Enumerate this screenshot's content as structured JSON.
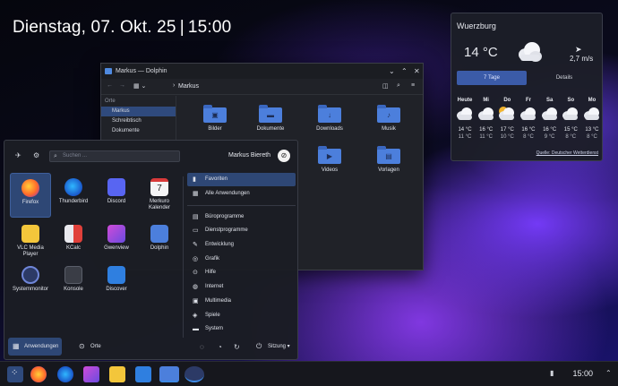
{
  "desktop": {
    "date": "Dienstag, 07. Okt. 25",
    "time": "15:00"
  },
  "weather": {
    "city": "Wuerzburg",
    "temp": "14 °C",
    "wind": "2,7 m/s",
    "tabs": [
      "7 Tage",
      "Details"
    ],
    "days": [
      {
        "name": "Heute",
        "hi": "14 °C",
        "lo": "11 °C",
        "icon": "cloud-icon"
      },
      {
        "name": "Mi",
        "hi": "16 °C",
        "lo": "11 °C",
        "icon": "cloud-icon"
      },
      {
        "name": "Do",
        "hi": "17 °C",
        "lo": "10 °C",
        "icon": "partly-sunny-icon"
      },
      {
        "name": "Fr",
        "hi": "16 °C",
        "lo": "8 °C",
        "icon": "cloud-icon"
      },
      {
        "name": "Sa",
        "hi": "16 °C",
        "lo": "9 °C",
        "icon": "cloud-icon"
      },
      {
        "name": "So",
        "hi": "15 °C",
        "lo": "8 °C",
        "icon": "cloud-icon"
      },
      {
        "name": "Mo",
        "hi": "13 °C",
        "lo": "8 °C",
        "icon": "cloud-icon"
      }
    ],
    "source": "Quelle: Deutscher Wetterdienst"
  },
  "dolphin": {
    "title": "Markus — Dolphin",
    "breadcrumb": "Markus",
    "sidebar_header": "Orte",
    "sidebar": [
      "Markus",
      "Schreibtisch",
      "Dokumente"
    ],
    "files": [
      "Bilder",
      "Dokumente",
      "Downloads",
      "Musik",
      "Videos",
      "Vorlagen"
    ]
  },
  "launcher": {
    "search_placeholder": "Suchen ...",
    "user": "Markus Biereth",
    "apps": [
      "Firefox",
      "Thunderbird",
      "Discord",
      "Merkuro Kalender",
      "VLC Media Player",
      "KCalc",
      "Gwenview",
      "Dolphin",
      "Systemmonitor",
      "Konsole",
      "Discover"
    ],
    "calendar_day": "7",
    "categories": [
      "Favoriten",
      "Alle Anwendungen",
      "Büroprogramme",
      "Dienstprogramme",
      "Entwicklung",
      "Grafik",
      "Hilfe",
      "Internet",
      "Multimedia",
      "Spiele",
      "System"
    ],
    "footer": {
      "apps": "Anwendungen",
      "places": "Orte",
      "session": "Sitzung"
    }
  },
  "taskbar": {
    "clock": "15:00"
  },
  "colors": {
    "accent": "#3d8ae6",
    "selection": "#2e4775",
    "folder": "#4c7fdc"
  }
}
